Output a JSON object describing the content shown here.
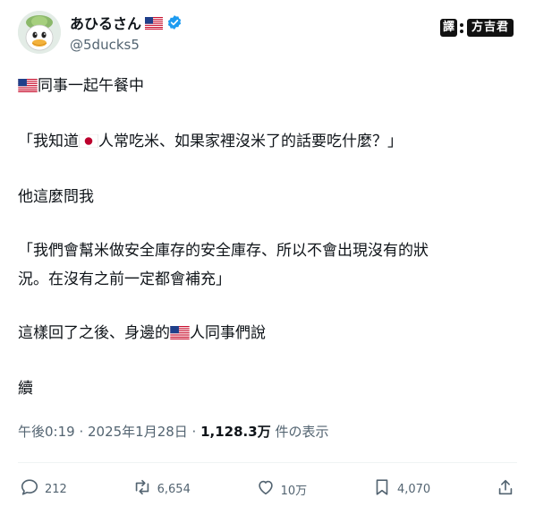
{
  "user": {
    "display_name": "あひるさん",
    "handle": "@5ducks5",
    "verified": true
  },
  "badge": {
    "label_left": "譯",
    "label_right": "方吉君"
  },
  "post": {
    "l1": "同事一起午餐中",
    "l2a": "「我知道",
    "l2b": "人常吃米、如果家裡沒米了的話要吃什麼？」",
    "l3": "他這麼問我",
    "l4": "「我們會幫米做安全庫存的安全庫存、所以不會出現沒有的狀",
    "l5": "況。在沒有之前一定都會補充」",
    "l6a": "這樣回了之後、身邊的",
    "l6b": "人同事們說",
    "l7": "續"
  },
  "meta": {
    "time": "午後0:19 · 2025年1月28日 · ",
    "views": "1,128.3万",
    "views_suffix": " 件の表示"
  },
  "actions": {
    "replies": "212",
    "reposts": "6,654",
    "likes": "10万",
    "bookmarks": "4,070"
  },
  "icons": {
    "us_flag": "us-flag-icon",
    "jp_flag": "japan-flag-icon",
    "verified": "verified-badge-icon"
  },
  "colors": {
    "accent": "#1d9bf0",
    "muted": "#536471",
    "text": "#0f1419"
  }
}
